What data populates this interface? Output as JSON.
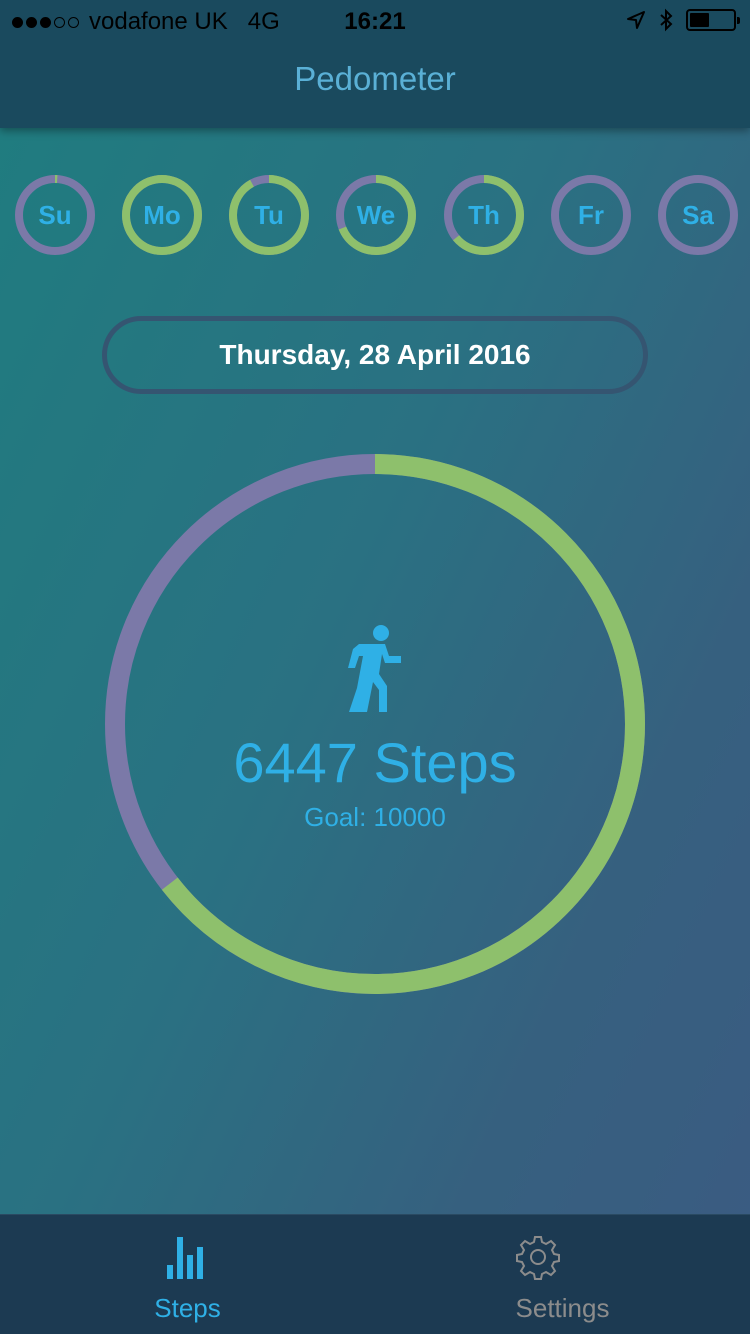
{
  "status_bar": {
    "carrier": "vodafone UK",
    "network": "4G",
    "time": "16:21",
    "signal_bars_filled": 3,
    "signal_bars_total": 5,
    "battery_level": 0.45
  },
  "nav": {
    "title": "Pedometer"
  },
  "days": [
    {
      "label": "Su",
      "progress": 0.01
    },
    {
      "label": "Mo",
      "progress": 1.0
    },
    {
      "label": "Tu",
      "progress": 0.92
    },
    {
      "label": "We",
      "progress": 0.69
    },
    {
      "label": "Th",
      "progress": 0.64
    },
    {
      "label": "Fr",
      "progress": 0.0
    },
    {
      "label": "Sa",
      "progress": 0.0
    }
  ],
  "date_label": "Thursday, 28 April 2016",
  "today": {
    "steps_text": "6447 Steps",
    "goal_text": "Goal: 10000",
    "steps": 6447,
    "goal": 10000
  },
  "colors": {
    "ring_progress": "#8ec06c",
    "ring_track": "#7b79a8",
    "accent": "#2fb0e6"
  },
  "tabs": [
    {
      "label": "Steps",
      "icon": "bar-chart-icon",
      "active": true
    },
    {
      "label": "Settings",
      "icon": "gear-icon",
      "active": false
    }
  ]
}
